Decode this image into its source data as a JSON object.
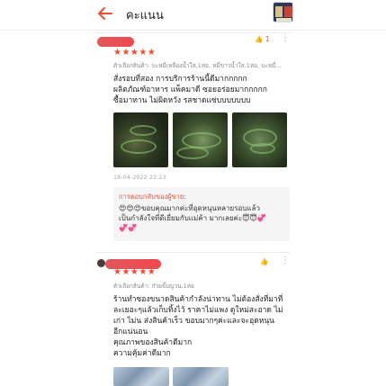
{
  "header": {
    "title": "คะแนน",
    "back_icon": "arrow-left-icon",
    "accent": "#ee4d2d"
  },
  "reviews": [
    {
      "stars": "★★★★★",
      "variant": "ตัวเลือกสินค้า: บะหมี่เหลืองน้ำใส,1ห่อ, หมี่ขาวน้ำใส,1ห่อ, บะหมี่...",
      "text": [
        "สั่งรอบที่สอง การบริการร้านนี้ดีมากกกกก",
        "ผลิตภัณฑ์อาหาร แพ็คมาดี ซอยอร่อยมากกกกก",
        "ซื้อมาทาน ไม่ผิดหวัง รสชาดแซ่บบบบบบบ"
      ],
      "likes": "1",
      "timestamp": "18-04-2022 22:23",
      "seller_reply": {
        "title": "การตอบกลับของผู้ขาย:",
        "text": [
          "😍😍😍ขอบคุณมากค่ะที่อุดหนุนหลายรอบแล้ว",
          "เป็นกำลังใจที่ดีเยี่ยมกับแม่ค้า มากเลยค่ะ😇😇💞",
          "💞💞"
        ]
      }
    },
    {
      "stars": "★★★★★",
      "variant": "ตัวเลือกสินค้า: ก๋วยจั๊บญวน,1ห่อ",
      "text": [
        "ร้านทำซองขนาดสินค้ากำลังน่าทาน ไม่ต้องสั่งที่มาที่",
        "ละเยอะๆแล้วเก็บทิ้งไว้ ราคาไม่แพง ดูใหม่สะอาด ไม่",
        "เก่า ไม่น ส่งสินค้าเร็ว ขอบมากๆค่ะและจะอุดหนุน",
        "อีกแน่นอน",
        "คุณภาพของสินค้าดีมาก",
        "ความคุ้มค่าดีมาก"
      ]
    }
  ]
}
